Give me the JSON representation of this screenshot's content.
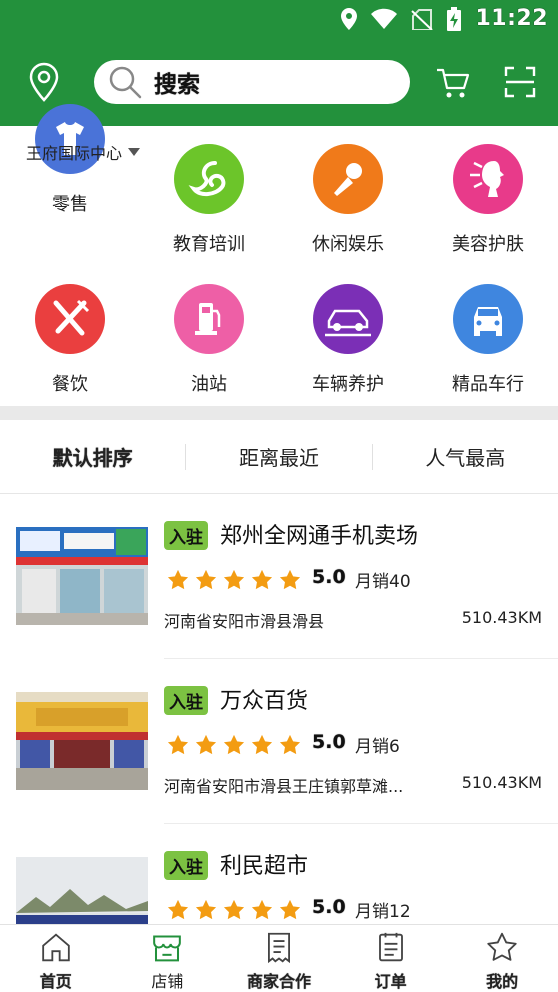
{
  "status_bar": {
    "time": "11:22"
  },
  "header": {
    "search_placeholder": "搜索"
  },
  "location": {
    "label": "王府国际中心"
  },
  "categories": [
    {
      "label": "零售",
      "icon": "shirt-icon",
      "color": "#4a73d8"
    },
    {
      "label": "教育培训",
      "icon": "education-swirl-icon",
      "color": "#6cc52a"
    },
    {
      "label": "休闲娱乐",
      "icon": "microphone-icon",
      "color": "#f07a1a"
    },
    {
      "label": "美容护肤",
      "icon": "beauty-face-icon",
      "color": "#e83a8a"
    },
    {
      "label": "餐饮",
      "icon": "fork-knife-icon",
      "color": "#ea3f3f"
    },
    {
      "label": "油站",
      "icon": "fuel-pump-icon",
      "color": "#ee5fa6"
    },
    {
      "label": "车辆养护",
      "icon": "car-lift-icon",
      "color": "#7b2fb6"
    },
    {
      "label": "精品车行",
      "icon": "car-front-icon",
      "color": "#3f86df"
    }
  ],
  "sort": {
    "options": [
      "默认排序",
      "距离最近",
      "人气最高"
    ],
    "active": 0
  },
  "stores": [
    {
      "badge": "入驻",
      "name": "郑州全网通手机卖场",
      "rating": "5.0",
      "sales": "月销40",
      "address": "河南省安阳市滑县滑县",
      "distance": "510.43KM",
      "stars": 5
    },
    {
      "badge": "入驻",
      "name": "万众百货",
      "rating": "5.0",
      "sales": "月销6",
      "address": "河南省安阳市滑县王庄镇郭草滩...",
      "distance": "510.43KM",
      "stars": 5
    },
    {
      "badge": "入驻",
      "name": "利民超市",
      "rating": "5.0",
      "sales": "月销12",
      "address": "",
      "distance": "",
      "stars": 5
    }
  ],
  "bottom_nav": [
    {
      "label": "首页",
      "icon": "home-icon"
    },
    {
      "label": "店铺",
      "icon": "store-icon"
    },
    {
      "label": "商家合作",
      "icon": "document-icon"
    },
    {
      "label": "订单",
      "icon": "order-list-icon"
    },
    {
      "label": "我的",
      "icon": "star-icon"
    }
  ],
  "bottom_nav_active": 1,
  "colors": {
    "primary": "#23913c",
    "badge": "#7cc242",
    "star": "#f39c12"
  }
}
